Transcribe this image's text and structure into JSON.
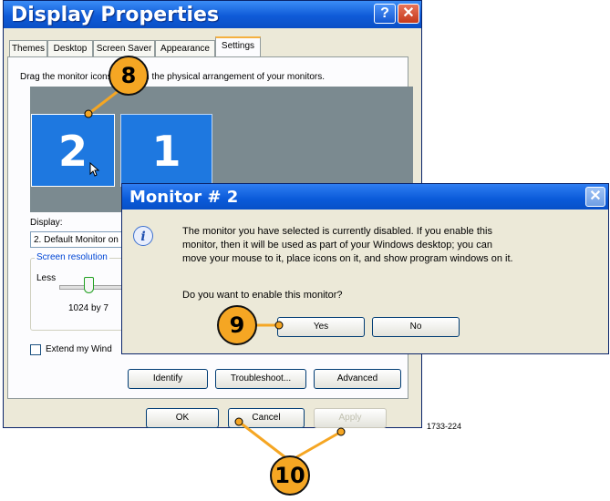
{
  "window": {
    "title": "Display Properties",
    "help_glyph": "?",
    "close_glyph": "✕"
  },
  "tabs": [
    {
      "label": "Themes"
    },
    {
      "label": "Desktop"
    },
    {
      "label": "Screen Saver"
    },
    {
      "label": "Appearance"
    },
    {
      "label": "Settings"
    }
  ],
  "settings": {
    "instruction": "Drag the monitor icons to match the physical arrangement of your monitors.",
    "monitor_2_label": "2",
    "monitor_1_label": "1",
    "display_label": "Display:",
    "display_value": "2. Default Monitor on",
    "resolution_group": "Screen resolution",
    "res_less": "Less",
    "res_value": "1024 by 7",
    "extend_label": "Extend my Wind"
  },
  "buttons": {
    "identify": "Identify",
    "troubleshoot": "Troubleshoot...",
    "advanced": "Advanced",
    "ok": "OK",
    "cancel": "Cancel",
    "apply": "Apply"
  },
  "dialog": {
    "title": "Monitor # 2",
    "close_glyph": "✕",
    "message_line1": "The monitor you have selected is currently disabled. If you enable this",
    "message_line2": "monitor, then it will be used as part of your Windows desktop; you can",
    "message_line3": "move your mouse to it, place icons on it, and show program windows on it.",
    "question": "Do you want to enable this monitor?",
    "yes": "Yes",
    "no": "No",
    "icon": "info-icon"
  },
  "callouts": {
    "c8": "8",
    "c9": "9",
    "c10": "10"
  },
  "figure_id": "1733-224",
  "colors": {
    "titlebar": "#0f5bd8",
    "monitor_blue": "#1e78e0",
    "callout": "#f5a623",
    "window_bg": "#ece9d8"
  }
}
